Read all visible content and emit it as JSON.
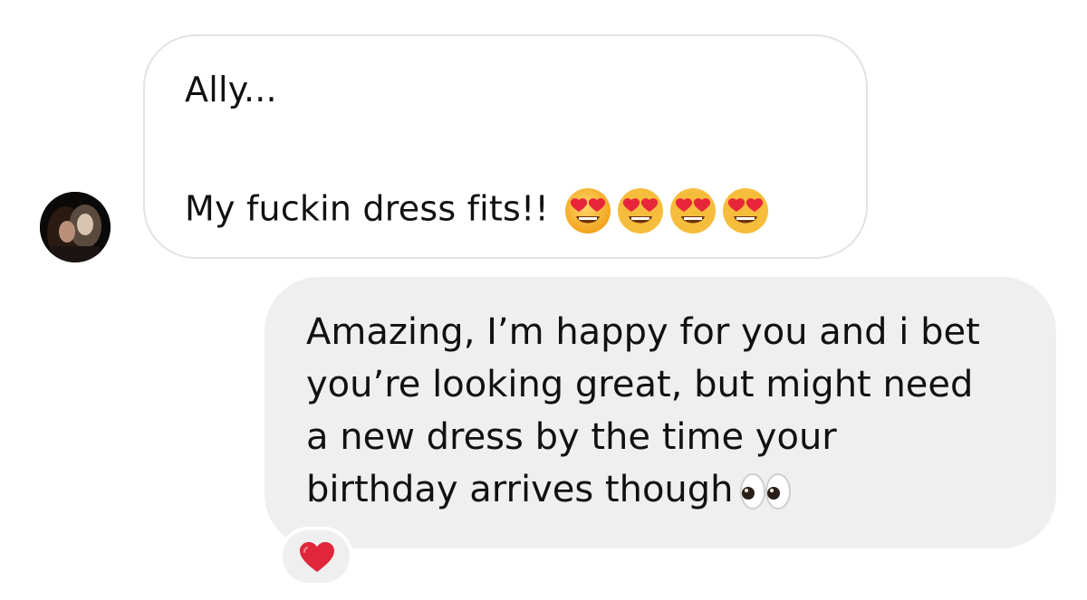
{
  "conversation": {
    "incoming": {
      "line1": "Ally...",
      "line2": "My fuckin dress fits!!",
      "emoji_name": "smiling-face-with-heart-eyes-icon",
      "emoji_count": 4
    },
    "outgoing": {
      "lines": [
        "Amazing, I’m happy for you and i bet",
        "you’re looking great, but might need",
        "a new dress by the time your",
        "birthday arrives though"
      ],
      "emoji_name": "eyes-icon"
    },
    "reaction": {
      "icon": "red-heart-icon"
    }
  },
  "colors": {
    "incoming_bubble_bg": "#ffffff",
    "incoming_bubble_border": "#e2e2e2",
    "outgoing_bubble_bg": "#efefef",
    "text": "#111111",
    "heart": "#e0263b"
  }
}
